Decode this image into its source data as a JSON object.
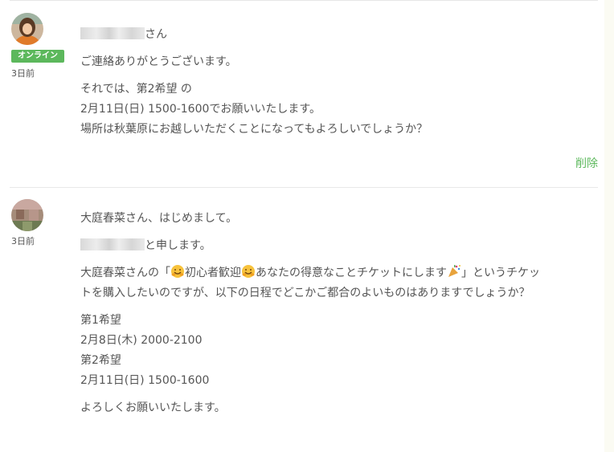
{
  "colors": {
    "accent_green": "#5cb85c",
    "text": "#555555",
    "divider": "#e8e8e8"
  },
  "messages": [
    {
      "online_badge": "オンライン",
      "time": "3日前",
      "greeting_suffix": "さん",
      "para1": "ご連絡ありがとうございます。",
      "para2_lines": [
        "それでは、第2希望 の",
        "2月11日(日) 1500-1600でお願いいたします。",
        "場所は秋葉原にお越しいただくことになってもよろしいでしょうか？"
      ],
      "delete_label": "削除"
    },
    {
      "time": "3日前",
      "para1": "大庭春菜さん、はじめまして。",
      "intro_suffix": "と申します。",
      "para3_a": "大庭春菜さんの「",
      "para3_b": "初心者歓迎",
      "para3_c": "あなたの得意なことチケットにします",
      "para3_d": "」というチケッ",
      "para3_line2": "トを購入したいのですが、以下の日程でどこかご都合のよいものはありますでしょうか？",
      "schedule_lines": [
        "第1希望",
        "2月8日(木) 2000-2100",
        "第2希望",
        "2月11日(日) 1500-1600"
      ],
      "closing": "よろしくお願いいたします。",
      "icons": {
        "emoji_a": "smiling-hugging-emoji",
        "emoji_b": "party-popper-emoji"
      }
    }
  ]
}
